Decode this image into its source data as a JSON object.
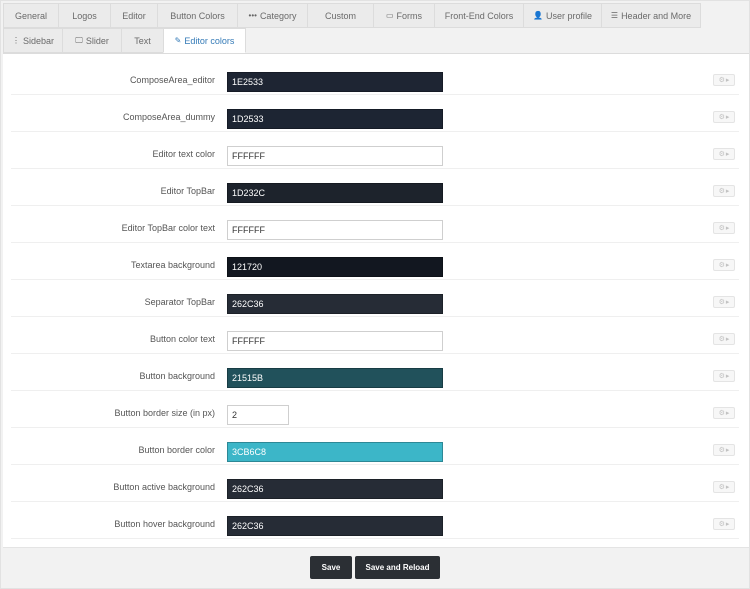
{
  "tabs": {
    "general": "General",
    "logos": "Logos",
    "editor": "Editor",
    "button_colors": "Button Colors",
    "category": "Category",
    "custom": "Custom",
    "forms": "Forms",
    "frontend_colors": "Front-End Colors",
    "user_profile": "User profile",
    "header_more": "Header and More",
    "sidebar": "Sidebar",
    "slider": "Slider",
    "text": "Text",
    "editor_colors": "Editor colors"
  },
  "tab_icons": {
    "category": "ellipsis-icon",
    "forms": "form-icon",
    "user_profile": "user-icon",
    "header_more": "database-icon",
    "sidebar": "vertical-ellipsis-icon",
    "slider": "desktop-icon",
    "editor_colors": "pencil-icon"
  },
  "active_tab": "Editor colors",
  "fields": [
    {
      "label": "ComposeArea_editor",
      "value": "1E2533",
      "bg": "#1E2533"
    },
    {
      "label": "ComposeArea_dummy",
      "value": "1D2533",
      "bg": "#1D2533"
    },
    {
      "label": "Editor text color",
      "value": "FFFFFF",
      "bg": "#FFFFFF"
    },
    {
      "label": "Editor TopBar",
      "value": "1D232C",
      "bg": "#1D232C"
    },
    {
      "label": "Editor TopBar color text",
      "value": "FFFFFF",
      "bg": "#FFFFFF"
    },
    {
      "label": "Textarea background",
      "value": "121720",
      "bg": "#121720"
    },
    {
      "label": "Separator TopBar",
      "value": "262C36",
      "bg": "#262C36"
    },
    {
      "label": "Button color text",
      "value": "FFFFFF",
      "bg": "#FFFFFF"
    },
    {
      "label": "Button background",
      "value": "21515B",
      "bg": "#21515B"
    },
    {
      "label": "Button border size (in px)",
      "value": "2"
    },
    {
      "label": "Button border color",
      "value": "3CB6C8",
      "bg": "#3CB6C8"
    },
    {
      "label": "Button active background",
      "value": "262C36",
      "bg": "#262C36"
    },
    {
      "label": "Button hover background",
      "value": "262C36",
      "bg": "#262C36"
    }
  ],
  "row_action_icon": "gear-icon",
  "footer": {
    "save_label": "Save",
    "save_reload_label": "Save and Reload"
  },
  "colors": {
    "active_tab_text": "#337ab7",
    "button_dark": "#2b2f34"
  }
}
